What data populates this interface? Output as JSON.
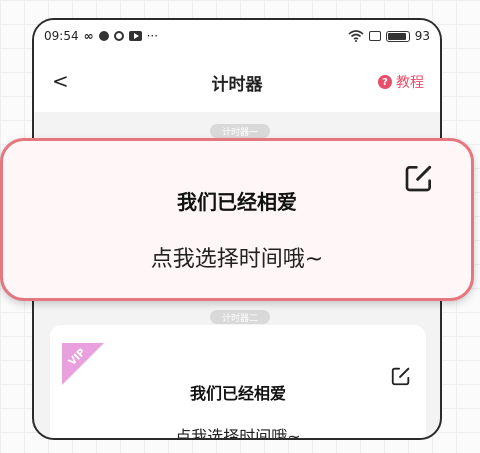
{
  "status_bar": {
    "time": "09:54",
    "battery": "93",
    "more": "···"
  },
  "nav": {
    "back": "<",
    "title": "计时器",
    "tutorial": "教程",
    "help_glyph": "?"
  },
  "cards": [
    {
      "label": "计时器一",
      "title": "我们已经相爱",
      "subtitle": "点我选择时间哦~"
    },
    {
      "label": "计时器二",
      "title": "我们已经相爱",
      "subtitle": "点我选择时间哦~",
      "badge": "VIP"
    }
  ],
  "colors": {
    "accent": "#e84e6a",
    "highlight_border": "#e57781",
    "vip": "#e9a0de"
  },
  "icons": [
    "wifi-icon",
    "battery-icon",
    "edit-icon",
    "help-icon",
    "back-icon"
  ]
}
